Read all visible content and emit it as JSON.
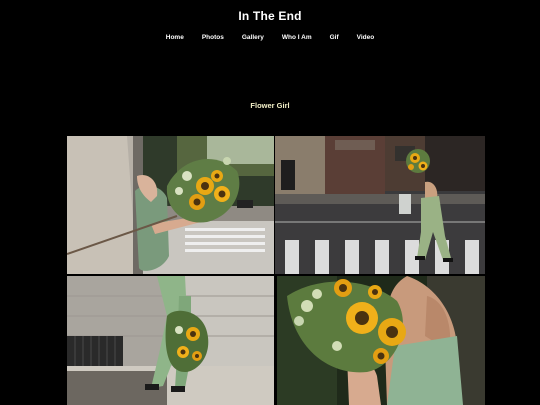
{
  "site": {
    "title": "In The End"
  },
  "nav": {
    "items": [
      {
        "label": "Home"
      },
      {
        "label": "Photos"
      },
      {
        "label": "Gallery"
      },
      {
        "label": "Who I Am"
      },
      {
        "label": "Gif"
      },
      {
        "label": "Video"
      }
    ]
  },
  "album": {
    "title": "Flower Girl"
  },
  "colors": {
    "background": "#000000",
    "album_title": "#f3f0c8",
    "sunflower": "#e8a814"
  },
  "gallery": {
    "photos": [
      {
        "subject": "woman holding sunflowers by wall"
      },
      {
        "subject": "woman walking crosswalk with sunflowers"
      },
      {
        "subject": "woman walking sidewalk with sunflowers"
      },
      {
        "subject": "close-up sunflower bouquet"
      }
    ]
  }
}
